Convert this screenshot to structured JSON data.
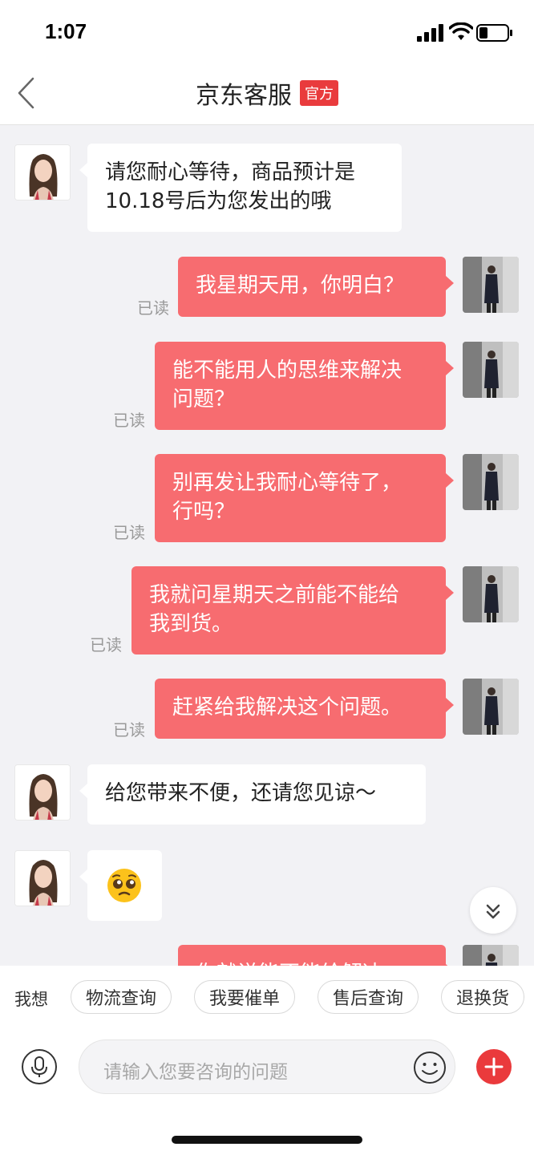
{
  "status_bar": {
    "time": "1:07"
  },
  "nav": {
    "title": "京东客服",
    "badge": "官方"
  },
  "chat": {
    "read_label": "已读",
    "messages": [
      {
        "sender": "agent",
        "text_lines": [
          "请您耐心等待，商品预计是",
          "10.18号后为您发出的哦"
        ]
      },
      {
        "sender": "user",
        "text_lines": [
          "我星期天用，你明白？"
        ],
        "status": "已读"
      },
      {
        "sender": "user",
        "text_lines": [
          "能不能用人的思维来解决",
          "问题？"
        ],
        "status": "已读"
      },
      {
        "sender": "user",
        "text_lines": [
          "别再发让我耐心等待了，",
          "行吗？"
        ],
        "status": "已读"
      },
      {
        "sender": "user",
        "text_lines": [
          "我就问星期天之前能不能给",
          "我到货。"
        ],
        "status": "已读"
      },
      {
        "sender": "user",
        "text_lines": [
          "赶紧给我解决这个问题。"
        ],
        "status": "已读"
      },
      {
        "sender": "agent",
        "text_lines": [
          "给您带来不便，还请您见谅～"
        ]
      },
      {
        "sender": "agent",
        "emoji": "pleading-face"
      },
      {
        "sender": "user",
        "text_lines": [
          "你就说能不能给解决"
        ],
        "partially_hidden": true
      }
    ]
  },
  "quick_bar": {
    "label": "我想",
    "chips": [
      "物流查询",
      "我要催单",
      "售后查询",
      "退换货"
    ]
  },
  "input": {
    "placeholder": "请输入您要咨询的问题"
  },
  "colors": {
    "user_bubble": "#f76c70",
    "accent": "#e93b3d",
    "background": "#f2f2f5"
  }
}
